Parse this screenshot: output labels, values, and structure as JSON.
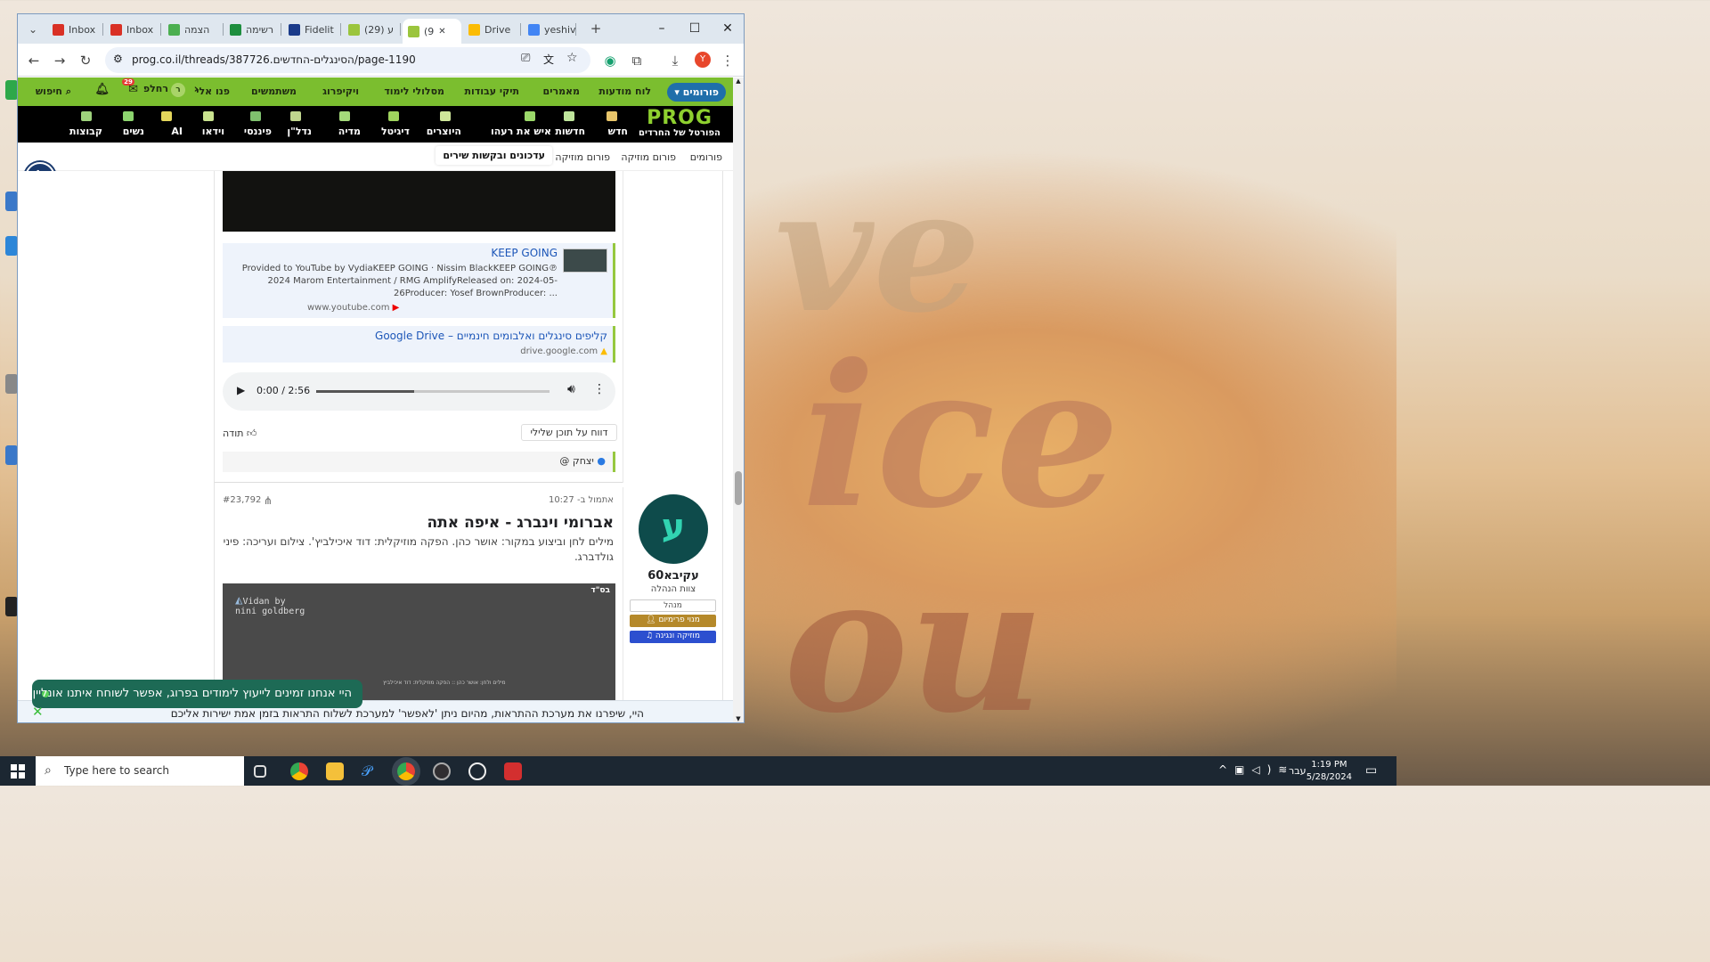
{
  "browser": {
    "tabs": [
      {
        "label": "Inbox",
        "color": "#d93025"
      },
      {
        "label": "Inbox",
        "color": "#d93025"
      },
      {
        "label": "הצמה",
        "color": "#4caf50"
      },
      {
        "label": "רשימה",
        "color": "#1e8e3e"
      },
      {
        "label": "Fidelit",
        "color": "#1a3b8a"
      },
      {
        "label": "(29) ע",
        "color": "#9bc53d"
      },
      {
        "label": "(9",
        "color": "#9bc53d"
      },
      {
        "label": "Drive",
        "color": "#fbbc04"
      },
      {
        "label": "yeshiv",
        "color": "#4285f4"
      }
    ],
    "url": "prog.co.il/threads/387726.הסינגלים-החדשים/page-1190",
    "profile_initial": "Y"
  },
  "site": {
    "nav": {
      "search": "חיפוש",
      "user": "רחלפ",
      "badge": "29",
      "panu_eli": "פנו אלי",
      "items": [
        "פורומים",
        "לוח מודעות",
        "מאמרים",
        "תיקי עבודות",
        "מסלולי לימוד",
        "ויקיפרוג",
        "משתמשים"
      ]
    },
    "logo": {
      "text": "PROG",
      "tagline": "הפורטל של החרדים"
    },
    "categories": [
      "חדש",
      "חדשות",
      "איש את רעהו",
      "היוצרים",
      "דיגיטל",
      "מדיה",
      "נדל\"ן",
      "פיננסי",
      "וידאו",
      "AI",
      "נשים",
      "קבוצות"
    ],
    "crumbs": [
      "פורומים",
      "פורום מוזיקה",
      "פורום מוזיקה",
      "עדכונים ובקשות שירים"
    ]
  },
  "post1": {
    "embed1": {
      "title": "KEEP GOING",
      "desc": "Provided to YouTube by VydiaKEEP GOING · Nissim BlackKEEP GOING℗ 2024 Marom Entertainment / RMG AmplifyReleased on: 2024-05-26Producer: Yosef BrownProducer: ...",
      "src": "www.youtube.com"
    },
    "embed2": {
      "title": "קליפים סינגלים ואלבומים חינמיים – Google Drive",
      "src": "drive.google.com"
    },
    "audio": {
      "time": "0:00 / 2:56",
      "progress": 0.42
    },
    "report": "דווח על תוכן שלילי",
    "thanks": "תודה",
    "likes": "יצחק @"
  },
  "post2": {
    "edited": "אתמול ב- 10:27",
    "number": "#23,792",
    "title": "אברומי וינברג - איפה אתה",
    "body": "מילים לחן וביצוע במקור: אושר כהן. הפקה מוזיקלית: דוד איכילביץ'. צילום ועריכה: פיני גולדברג.",
    "video_tag": "בס\"ד",
    "video_brand": "Vidan by\nnini goldberg",
    "video_credit": "מילים ולחן: אושר כהן :: הפקה מוזיקלית: דוד איכילביץ",
    "user": {
      "avatar": "ע",
      "name": "עקיבא60",
      "role": "צוות הנהלה",
      "tag1": "מנהל",
      "tag2": "מנוי פרימיום",
      "tag3": "מוזיקה ונגינה"
    }
  },
  "notice": "היי, שיפרנו את מערכת ההתראות, מהיום ניתן 'לאפשר' למערכת לשלוח התראות בזמן אמת ישירות אליכם",
  "toast": "היי אנחנו זמינים לייעוץ לימודים בפרוג, אפשר לשוחח איתנו אונליין",
  "taskbar": {
    "search": "Type here to search",
    "lang": "עבר",
    "time": "1:19 PM",
    "date": "5/28/2024"
  }
}
